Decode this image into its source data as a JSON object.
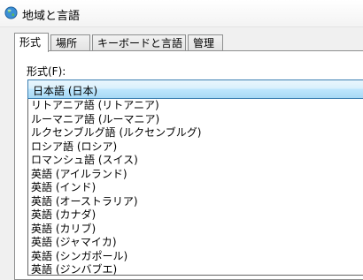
{
  "window": {
    "title": "地域と言語",
    "icon": "globe-icon"
  },
  "tabs": [
    {
      "label": "形式",
      "active": true
    },
    {
      "label": "場所",
      "active": false
    },
    {
      "label": "キーボードと言語",
      "active": false
    },
    {
      "label": "管理",
      "active": false
    }
  ],
  "format": {
    "label": "形式(F):",
    "selected": "日本語 (日本)",
    "options": [
      "リトアニア語 (リトアニア)",
      "ルーマニア語 (ルーマニア)",
      "ルクセンブルグ語 (ルクセンブルグ)",
      "ロシア語 (ロシア)",
      "ロマンシュ語 (スイス)",
      "英語 (アイルランド)",
      "英語 (インド)",
      "英語 (オーストラリア)",
      "英語 (カナダ)",
      "英語 (カリブ)",
      "英語 (ジャマイカ)",
      "英語 (シンガポール)",
      "英語 (ジンバブエ)"
    ]
  },
  "colors": {
    "accent_border": "#3c7fb1",
    "combo_fill": "#bee6fd",
    "background": "#f0f0f0"
  }
}
